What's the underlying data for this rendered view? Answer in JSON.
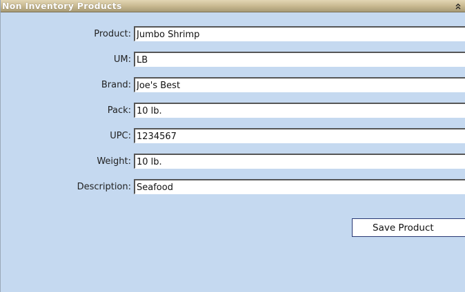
{
  "panel": {
    "title": "Non Inventory Products",
    "collapse_icon": "double-chevron-up"
  },
  "form": {
    "fields": [
      {
        "label": "Product:",
        "value": "Jumbo Shrimp"
      },
      {
        "label": "UM:",
        "value": "LB"
      },
      {
        "label": "Brand:",
        "value": "Joe's Best"
      },
      {
        "label": "Pack:",
        "value": "10 lb."
      },
      {
        "label": "UPC:",
        "value": "1234567"
      },
      {
        "label": "Weight:",
        "value": "10 lb."
      },
      {
        "label": "Description:",
        "value": "Seafood"
      }
    ],
    "save_label": "Save Product"
  },
  "colors": {
    "panel_background": "#c5d9f0",
    "title_bar": "#c6b78e",
    "button_border": "#263673"
  }
}
